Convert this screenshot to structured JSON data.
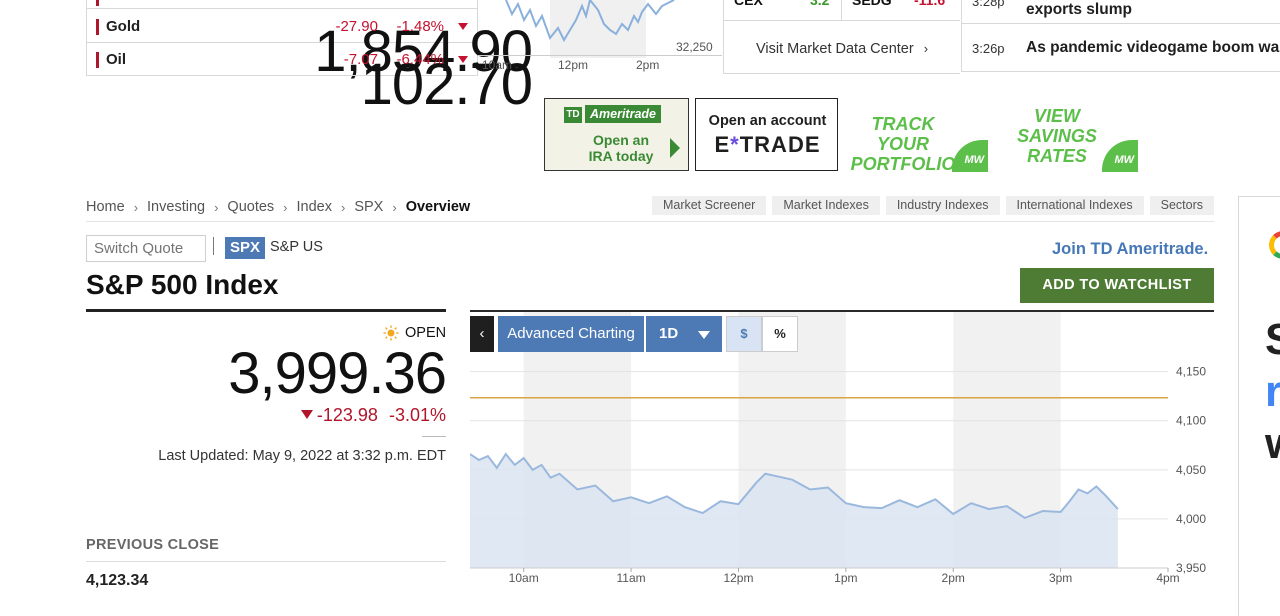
{
  "market_table": {
    "rows": [
      {
        "name": "Gold",
        "price": "1,854.90",
        "change": "-27.90",
        "pct": "-1.48%"
      },
      {
        "name": "Oil",
        "price": "102.70",
        "change": "-7.07",
        "pct": "-6.44%"
      }
    ]
  },
  "mini_chart": {
    "y_label": "32,250",
    "x_labels": [
      "10am",
      "12pm",
      "2pm"
    ]
  },
  "movers": {
    "row": [
      {
        "symbol": "CEX",
        "change": "3.2"
      },
      {
        "symbol": "SEDG",
        "change": "-11.6"
      }
    ],
    "visit_link": "Visit Market Data Center"
  },
  "news": [
    {
      "time": "3:28p",
      "title": "exports slump"
    },
    {
      "time": "3:26p",
      "title": "As pandemic videogame boom wa"
    }
  ],
  "ads": {
    "td": {
      "brand": "Ameritrade",
      "logo": "TD",
      "copy_line1": "Open an",
      "copy_line2": "IRA today"
    },
    "etrade": {
      "copy": "Open an account",
      "brand_pre": "E",
      "brand_star": "*",
      "brand_post": "TRADE"
    },
    "mw1": {
      "line1": "TRACK YOUR",
      "line2": "PORTFOLIO",
      "badge": "MW"
    },
    "mw2": {
      "line1": "VIEW",
      "line2": "SAVINGS",
      "line3": "RATES",
      "badge": "MW"
    }
  },
  "breadcrumb": [
    "Home",
    "Investing",
    "Quotes",
    "Index",
    "SPX",
    "Overview"
  ],
  "quick_links": [
    "Market Screener",
    "Market Indexes",
    "Industry Indexes",
    "International Indexes",
    "Sectors"
  ],
  "quote": {
    "switch_placeholder": "Switch Quote",
    "symbol": "SPX",
    "exchange": "S&P US",
    "title": "S&P 500 Index",
    "status": "OPEN",
    "price": "3,999.36",
    "change": "-123.98",
    "change_pct": "-3.01%",
    "last_updated": "Last Updated: May 9, 2022 at 3:32 p.m. EDT",
    "previous_close_label": "PREVIOUS CLOSE",
    "previous_close": "4,123.34"
  },
  "actions": {
    "join_td": "Join TD Ameritrade.",
    "watchlist": "ADD TO WATCHLIST"
  },
  "chart_toolbar": {
    "back": "‹",
    "advanced": "Advanced Charting",
    "range": "1D",
    "dollar": "$",
    "percent": "%"
  },
  "colors": {
    "down": "#c41230",
    "accent_blue": "#4d79b5",
    "watch_green": "#4f7c34",
    "prev_close_line": "#d9a441",
    "area_fill": "#dbe5f1",
    "line": "#9ab8dd"
  },
  "side_ad": {
    "lines": [
      "S",
      "r",
      "w"
    ]
  },
  "chart_data": {
    "type": "area",
    "title": "",
    "xlabel": "",
    "ylabel": "",
    "x_ticks": [
      "10am",
      "11am",
      "12pm",
      "1pm",
      "2pm",
      "3pm",
      "4pm"
    ],
    "y_ticks": [
      "4,150",
      "4,100",
      "4,050",
      "4,000",
      "3,950"
    ],
    "ylim": [
      3950,
      4170
    ],
    "xlim": [
      "9:30",
      "16:00"
    ],
    "previous_close": 4123.34,
    "series": [
      {
        "x": [
          "9:30",
          "9:35",
          "9:40",
          "9:45",
          "9:50",
          "9:55",
          "10:00",
          "10:05",
          "10:10",
          "10:15",
          "10:20",
          "10:30",
          "10:40",
          "10:50",
          "11:00",
          "11:10",
          "11:20",
          "11:30",
          "11:40",
          "11:50",
          "12:00",
          "12:10",
          "12:15",
          "12:20",
          "12:30",
          "12:40",
          "12:50",
          "13:00",
          "13:10",
          "13:20",
          "13:30",
          "13:40",
          "13:50",
          "14:00",
          "14:10",
          "14:20",
          "14:30",
          "14:40",
          "14:50",
          "15:00",
          "15:05",
          "15:10",
          "15:15",
          "15:20",
          "15:25",
          "15:32"
        ],
        "values": [
          4066,
          4060,
          4064,
          4052,
          4066,
          4055,
          4062,
          4050,
          4055,
          4042,
          4046,
          4030,
          4034,
          4018,
          4022,
          4016,
          4023,
          4012,
          4006,
          4018,
          4015,
          4037,
          4046,
          4044,
          4040,
          4030,
          4032,
          4016,
          4012,
          4011,
          4019,
          4012,
          4020,
          4005,
          4016,
          4010,
          4013,
          4001,
          4008,
          4007,
          4018,
          4030,
          4026,
          4033,
          4024,
          4010
        ]
      }
    ]
  }
}
